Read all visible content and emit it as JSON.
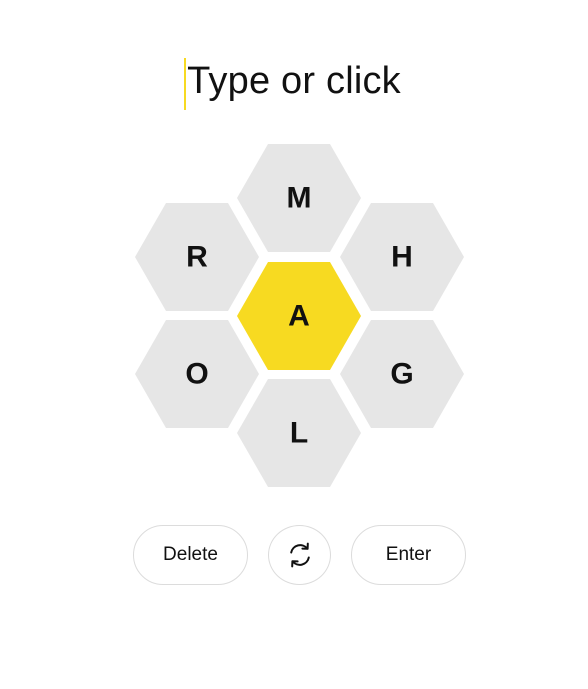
{
  "input": {
    "placeholder": "Type or click"
  },
  "hive": {
    "center_letter": "A",
    "outer_letters": [
      "M",
      "H",
      "G",
      "L",
      "O",
      "R"
    ],
    "colors": {
      "center": "#f7da21",
      "outer": "#e6e6e6",
      "letter": "#111111"
    }
  },
  "controls": {
    "delete_label": "Delete",
    "shuffle_icon": "shuffle-icon",
    "enter_label": "Enter"
  }
}
